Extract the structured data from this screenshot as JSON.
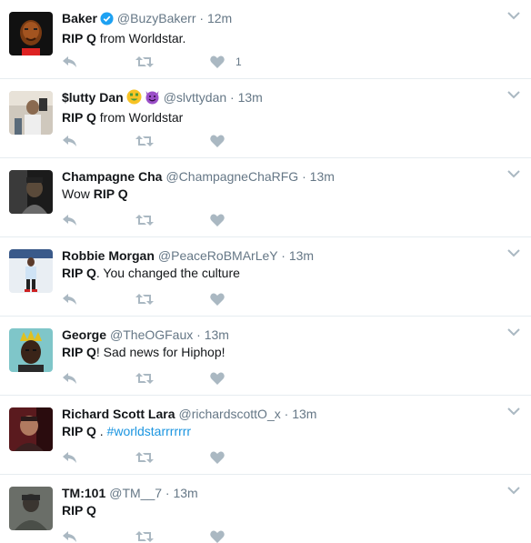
{
  "colors": {
    "name": "#14171a",
    "meta": "#657786",
    "action_icon": "#aab8c2",
    "hashtag": "#1b95e0",
    "divider": "#e6ecf0",
    "verified": "#1da1f2"
  },
  "tweets": [
    {
      "name": "Baker",
      "verified": true,
      "emojis": [],
      "handle": "@BuzyBakerr",
      "sep": "·",
      "time": "12m",
      "text_bold": "RIP Q",
      "text_rest": " from Worldstar.",
      "hashtag": "",
      "like_count": "1",
      "avatar_icon": "avatar-baker"
    },
    {
      "name": "$lutty Dan",
      "verified": false,
      "emojis": [
        "money-mouth-face",
        "smiling-imp"
      ],
      "handle": "@slvttydan",
      "sep": "·",
      "time": "13m",
      "text_bold": "RIP Q",
      "text_rest": " from Worldstar",
      "hashtag": "",
      "like_count": "",
      "avatar_icon": "avatar-slutty-dan"
    },
    {
      "name": "Champagne Cha",
      "verified": false,
      "emojis": [],
      "handle": "@ChampagneChaRFG",
      "sep": "·",
      "time": "13m",
      "text_pre": "Wow ",
      "text_bold": "RIP Q",
      "text_rest": "",
      "hashtag": "",
      "like_count": "",
      "avatar_icon": "avatar-champagne-cha"
    },
    {
      "name": "Robbie Morgan",
      "verified": false,
      "emojis": [],
      "handle": "@PeaceRoBMArLeY",
      "sep": "·",
      "time": "13m",
      "text_bold": "RIP Q",
      "text_rest": ". You changed the culture",
      "hashtag": "",
      "like_count": "",
      "avatar_icon": "avatar-robbie-morgan"
    },
    {
      "name": "George",
      "verified": false,
      "emojis": [],
      "handle": "@TheOGFaux",
      "sep": "·",
      "time": "13m",
      "text_bold": "RIP Q",
      "text_rest": "! Sad news for Hiphop!",
      "hashtag": "",
      "like_count": "",
      "avatar_icon": "avatar-george"
    },
    {
      "name": "Richard Scott Lara",
      "verified": false,
      "emojis": [],
      "handle": "@richardscottO_x",
      "sep": "·",
      "time": "13m",
      "text_bold": "RIP Q",
      "text_rest": " . ",
      "hashtag": "#worldstarrrrrrr",
      "like_count": "",
      "avatar_icon": "avatar-richard-scott-lara"
    },
    {
      "name": "TM:101",
      "verified": false,
      "emojis": [],
      "handle": "@TM__7",
      "sep": "·",
      "time": "13m",
      "text_bold": "RIP Q",
      "text_rest": "",
      "hashtag": "",
      "like_count": "",
      "avatar_icon": "avatar-tm101"
    }
  ]
}
